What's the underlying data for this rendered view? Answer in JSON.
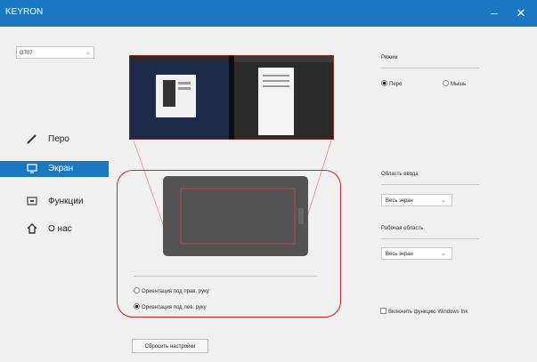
{
  "window": {
    "title": "KEYRON",
    "minimize": "–",
    "close": "✕"
  },
  "device_select": {
    "value": "G707",
    "arrow_icon": "chevron-down-icon"
  },
  "nav": [
    {
      "label": "Перо",
      "icon": "pen-icon"
    },
    {
      "label": "Экран",
      "icon": "monitor-icon",
      "active": true
    },
    {
      "label": "Функции",
      "icon": "keyboard-icon"
    },
    {
      "label": "О нас",
      "icon": "home-icon"
    }
  ],
  "mode": {
    "label": "Режим",
    "options": [
      {
        "label": "Перо",
        "checked": true
      },
      {
        "label": "Мышь",
        "checked": false
      }
    ]
  },
  "input_area": {
    "label": "Область ввода",
    "value": "Весь экран"
  },
  "work_area": {
    "label": "Рабочая область",
    "value": "Весь экран"
  },
  "orientation": {
    "options": [
      {
        "label": "Ориентация под прав. руку",
        "checked": false
      },
      {
        "label": "Ориентация под лев. руку",
        "checked": true
      }
    ]
  },
  "windows_ink": {
    "label": "Включить функцию Windows Ink",
    "checked": false
  },
  "reset_button": "Сбросить настройки",
  "colors": {
    "accent": "#1a78c2",
    "highlight": "#d42020"
  }
}
